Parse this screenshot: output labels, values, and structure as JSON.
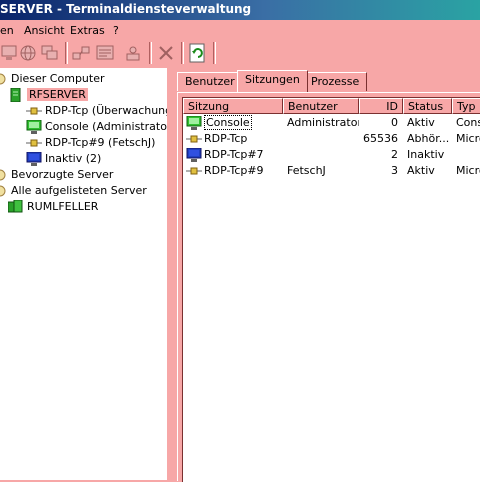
{
  "window": {
    "title": "SERVER - Terminaldiensteverwaltung"
  },
  "menu": {
    "items": [
      {
        "label": "en"
      },
      {
        "label": "Ansicht"
      },
      {
        "label": "Extras"
      },
      {
        "label": "?"
      }
    ]
  },
  "toolbar": {
    "buttons": [
      {
        "icon": "monitor-icon"
      },
      {
        "icon": "globe-icon"
      },
      {
        "icon": "windows-icon"
      },
      {
        "icon": "connect-icon"
      },
      {
        "icon": "message-icon"
      },
      {
        "icon": "disconnect-icon"
      },
      {
        "icon": "refresh-icon"
      }
    ]
  },
  "tree": {
    "root": "Dieser Computer",
    "server": "RFSERVER",
    "sessions": [
      {
        "label": "RDP-Tcp (Überwachungs",
        "icon": "network-icon"
      },
      {
        "label": "Console (Administrator)",
        "icon": "console-icon"
      },
      {
        "label": "RDP-Tcp#9 (FetschJ)",
        "icon": "network-icon"
      },
      {
        "label": "Inaktiv (2)",
        "icon": "monitor-icon"
      }
    ],
    "preferred": "Bevorzugte Server",
    "all": "Alle aufgelisteten Server",
    "domain": "RUMLFELLER"
  },
  "tabs": [
    {
      "label": "Benutzer"
    },
    {
      "label": "Sitzungen"
    },
    {
      "label": "Prozesse"
    }
  ],
  "table": {
    "columns": [
      "Sitzung",
      "Benutzer",
      "ID",
      "Status",
      "Typ"
    ],
    "rows": [
      {
        "session": "Console",
        "user": "Administrator",
        "id": "0",
        "status": "Aktiv",
        "type": "Conso",
        "icon": "console-icon"
      },
      {
        "session": "RDP-Tcp",
        "user": "",
        "id": "65536",
        "status": "Abhör...",
        "type": "Micro",
        "icon": "network-icon"
      },
      {
        "session": "RDP-Tcp#7",
        "user": "",
        "id": "2",
        "status": "Inaktiv",
        "type": "",
        "icon": "monitor-icon"
      },
      {
        "session": "RDP-Tcp#9",
        "user": "FetschJ",
        "id": "3",
        "status": "Aktiv",
        "type": "Micro",
        "icon": "network-icon"
      }
    ]
  },
  "colors": {
    "accent": "#f7a7a7",
    "title_start": "#0a246a",
    "title_end": "#2aa3a3"
  }
}
